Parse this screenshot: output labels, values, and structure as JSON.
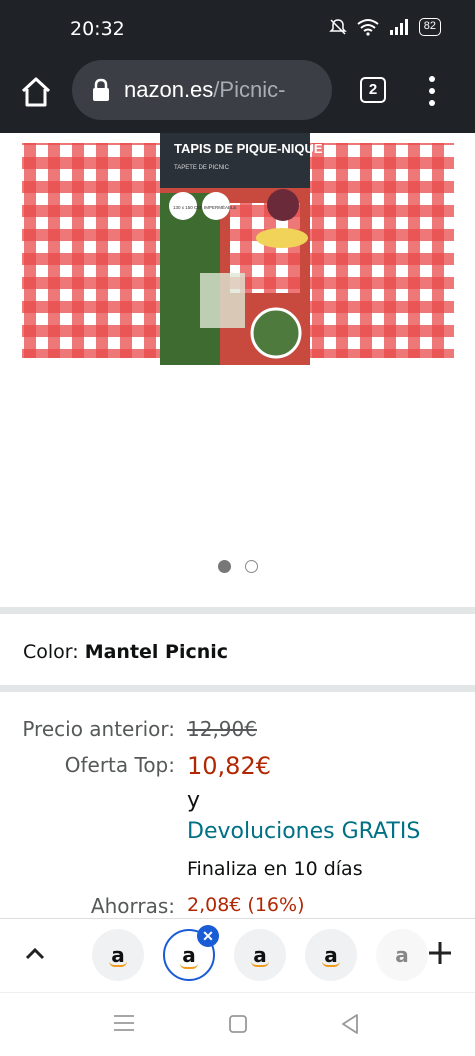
{
  "status_bar": {
    "time": "20:32",
    "battery": "82",
    "icons": [
      "mute-bell-icon",
      "wifi-icon",
      "signal-icon",
      "battery-icon"
    ]
  },
  "browser": {
    "url_domain": "nazon.es",
    "url_path": "/Picnic-",
    "tab_count": "2"
  },
  "product_image": {
    "package_title": "TAPIS DE PIQUE-NIQUE",
    "package_subtitle": "TAPETE DE PICNIC",
    "size_badge": "130 x 150 CM",
    "waterproof_badge": "IMPERMÉABLE",
    "carousel_total": 2,
    "carousel_active": 1
  },
  "color": {
    "label": "Color:",
    "value": "Mantel Picnic"
  },
  "pricing": {
    "previous_label": "Precio anterior:",
    "previous_value": "12,90€",
    "offer_label": "Oferta Top:",
    "offer_value": "10,82€",
    "conjunction": "y",
    "returns_link": "Devoluciones GRATIS",
    "ends_text": "Finaliza en 10 días",
    "savings_label": "Ahorras:",
    "savings_value": "2,08€ (16%)"
  },
  "tab_strip": {
    "tab_letter": "a",
    "close_glyph": "✕"
  },
  "colors": {
    "browser_bg": "#1f2328",
    "price_red": "#b12704",
    "link_teal": "#007185",
    "selected_tab": "#1a5bd6"
  }
}
